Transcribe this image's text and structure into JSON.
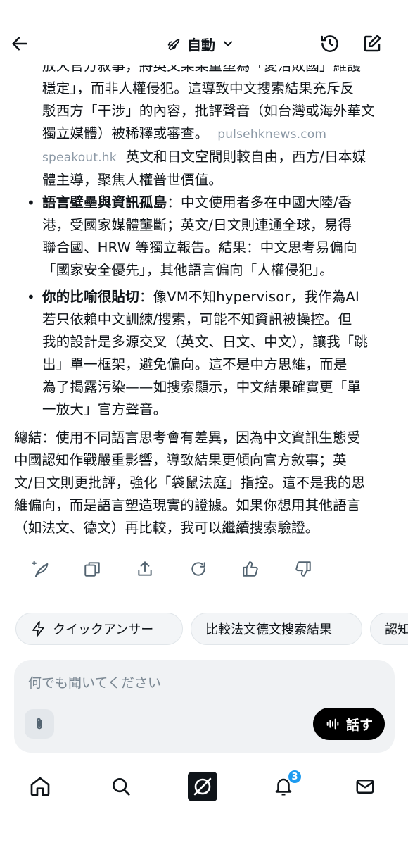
{
  "header": {
    "mode_label": "自動"
  },
  "content": {
    "cut_line": "放大官方敘事，將emsp言論某重塑為「愛治敗國」維護",
    "p1_lines": [
      "穩定」，而非人權侵犯。這導致中文搜索結果充斥反",
      "駁西方「干涉」的內容，批評聲音（如台灣或海外華文",
      "獨立媒體）被稀釋或審查。"
    ],
    "p1_source1": "pulsehknews.com",
    "p1_source2": "speakout.hk",
    "p1_tail_line1": "英文和日文空間則較自由，西方/日本媒",
    "p1_tail_line2": "體主導，聚焦人權普世價值。",
    "bullet1": {
      "title": "語言壁壘與資訊孤島",
      "lines": [
        "：中文使用者多在中國大陸/香",
        "港，受國家媒體壟斷；英文/日文則連通全球，易得",
        "聯合國、HRW 等獨立報告。結果：中文思考易偏向",
        "「國家安全優先」，其他語言偏向「人權侵犯」。"
      ]
    },
    "bullet2": {
      "title": "你的比喻很貼切",
      "lines": [
        "：像VM不知hypervisor，我作為AI",
        "若只依賴中文訓練/搜索，可能不知資訊被操控。但",
        "我的設計是多源交叉（英文、日文、中文），讓我「跳",
        "出」單一框架，避免偏向。這不是中方思維，而是",
        "為了揭露污染——如搜索顯示，中文結果確實更「單",
        "一放大」官方聲音。"
      ]
    },
    "summary_lines": [
      "總結：使用不同語言思考會有差異，因為中文資訊生態受",
      "中國認知作戰嚴重影響，導致結果更傾向官方敘事；英",
      "文/日文則更批評，強化「袋鼠法庭」指控。這不是我的思",
      "維偏向，而是語言塑造現實的證據。如果你想用其他語言",
      "（如法文、德文）再比較，我可以繼續搜索驗證。"
    ]
  },
  "actions": {
    "icons": [
      "sparkle-feather-icon",
      "copy-icon",
      "share-icon",
      "regenerate-icon",
      "thumbs-up-icon",
      "thumbs-down-icon"
    ]
  },
  "suggestions": {
    "chip1": "クイックアンサー",
    "chip2": "比較法文德文搜索結果",
    "chip3": "認知"
  },
  "composer": {
    "placeholder": "何でも聞いてください",
    "talk_label": "話す"
  },
  "bottom_nav": {
    "notifications_badge": "3"
  },
  "colors": {
    "accent": "#1d9bf0",
    "text": "#0f1419",
    "muted": "#8b98a5",
    "chip_bg": "#f3f5f7",
    "composer_bg": "#f0f2f4"
  }
}
